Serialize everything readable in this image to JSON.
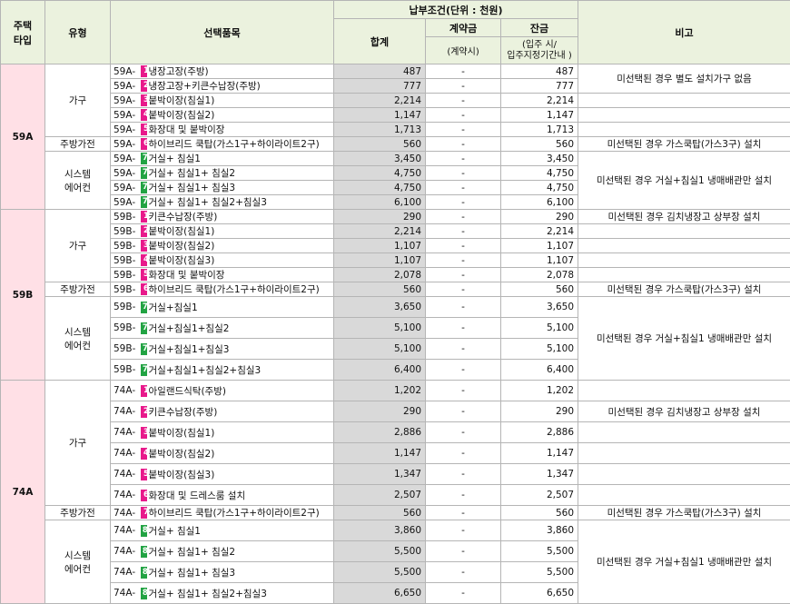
{
  "header": {
    "housing_type": "주택\n타입",
    "category": "유형",
    "item": "선택품목",
    "payment": "납부조건(단위 : 천원)",
    "total": "합계",
    "contract": "계약금",
    "contract_sub": "(계약시)",
    "balance": "잔금",
    "balance_sub": "(입주 시/\n입주지정기간내 )",
    "note": "비고"
  },
  "colors": {
    "header_bg": "#ebf2de",
    "type_bg": "#ffe0e6",
    "total_bg": "#d9d9d9",
    "pink_badge": "#e8198b",
    "green_badge": "#22a343"
  },
  "types": [
    {
      "name": "59A",
      "groups": [
        {
          "category": "가구",
          "rows": [
            {
              "code": "59A-",
              "badge": "1",
              "color": "pink",
              "name": "냉장고장(주방)",
              "total": "487",
              "contract": "-",
              "balance": "487"
            },
            {
              "code": "59A-",
              "badge": "2",
              "color": "pink",
              "name": "냉장고장+키큰수납장(주방)",
              "total": "777",
              "contract": "-",
              "balance": "777"
            },
            {
              "code": "59A-",
              "badge": "3",
              "color": "pink",
              "name": "붙박이장(침실1)",
              "total": "2,214",
              "contract": "-",
              "balance": "2,214"
            },
            {
              "code": "59A-",
              "badge": "4",
              "color": "pink",
              "name": "붙박이장(침실2)",
              "total": "1,147",
              "contract": "-",
              "balance": "1,147"
            },
            {
              "code": "59A-",
              "badge": "5",
              "color": "pink",
              "name": "화장대 및 붙박이장",
              "total": "1,713",
              "contract": "-",
              "balance": "1,713"
            }
          ]
        },
        {
          "category": "주방가전",
          "rows": [
            {
              "code": "59A-",
              "badge": "6",
              "color": "pink",
              "name": "하이브리드 쿡탑(가스1구+하이라이트2구)",
              "total": "560",
              "contract": "-",
              "balance": "560"
            }
          ]
        },
        {
          "category": "시스템\n에어컨",
          "rows": [
            {
              "code": "59A-",
              "badge": "7-1",
              "color": "green",
              "name": "거실+ 침실1",
              "total": "3,450",
              "contract": "-",
              "balance": "3,450"
            },
            {
              "code": "59A-",
              "badge": "7-2",
              "color": "green",
              "name": "거실+ 침실1+ 침실2",
              "total": "4,750",
              "contract": "-",
              "balance": "4,750"
            },
            {
              "code": "59A-",
              "badge": "7-3",
              "color": "green",
              "name": "거실+ 침실1+ 침실3",
              "total": "4,750",
              "contract": "-",
              "balance": "4,750"
            },
            {
              "code": "59A-",
              "badge": "7-4",
              "color": "green",
              "name": "거실+ 침실1+ 침실2+침실3",
              "total": "6,100",
              "contract": "-",
              "balance": "6,100"
            }
          ]
        }
      ],
      "notes": [
        {
          "row": 0,
          "span": 2,
          "text": "미선택된 경우 별도 설치가구 없음"
        },
        {
          "row": 2,
          "span": 1,
          "text": ""
        },
        {
          "row": 3,
          "span": 1,
          "text": ""
        },
        {
          "row": 4,
          "span": 1,
          "text": ""
        },
        {
          "row": 5,
          "span": 1,
          "text": "미선택된 경우 가스쿡탑(가스3구) 설치"
        },
        {
          "row": 6,
          "span": 4,
          "text": "미선택된 경우 거실+침실1 냉매배관만 설치"
        }
      ]
    },
    {
      "name": "59B",
      "groups": [
        {
          "category": "가구",
          "rows": [
            {
              "code": "59B-",
              "badge": "1",
              "color": "pink",
              "name": "키큰수납장(주방)",
              "total": "290",
              "contract": "-",
              "balance": "290"
            },
            {
              "code": "59B-",
              "badge": "2",
              "color": "pink",
              "name": "붙박이장(침실1)",
              "total": "2,214",
              "contract": "-",
              "balance": "2,214"
            },
            {
              "code": "59B-",
              "badge": "3",
              "color": "pink",
              "name": "붙박이장(침실2)",
              "total": "1,107",
              "contract": "-",
              "balance": "1,107"
            },
            {
              "code": "59B-",
              "badge": "4",
              "color": "pink",
              "name": "붙박이장(침실3)",
              "total": "1,107",
              "contract": "-",
              "balance": "1,107"
            },
            {
              "code": "59B-",
              "badge": "5",
              "color": "pink",
              "name": "화장대 및 붙박이장",
              "total": "2,078",
              "contract": "-",
              "balance": "2,078"
            }
          ]
        },
        {
          "category": "주방가전",
          "rows": [
            {
              "code": "59B-",
              "badge": "6",
              "color": "pink",
              "name": "하이브리드 쿡탑(가스1구+하이라이트2구)",
              "total": "560",
              "contract": "-",
              "balance": "560"
            }
          ]
        },
        {
          "category": "시스템\n에어컨",
          "tall": true,
          "rows": [
            {
              "code": "59B-",
              "badge": "7-1",
              "color": "green",
              "name": "거실+침실1",
              "total": "3,650",
              "contract": "-",
              "balance": "3,650"
            },
            {
              "code": "59B-",
              "badge": "7-2",
              "color": "green",
              "name": "거실+침실1+침실2",
              "total": "5,100",
              "contract": "-",
              "balance": "5,100"
            },
            {
              "code": "59B-",
              "badge": "7-3",
              "color": "green",
              "name": "거실+침실1+침실3",
              "total": "5,100",
              "contract": "-",
              "balance": "5,100"
            },
            {
              "code": "59B-",
              "badge": "7-4",
              "color": "green",
              "name": "거실+침실1+침실2+침실3",
              "total": "6,400",
              "contract": "-",
              "balance": "6,400"
            }
          ]
        }
      ],
      "notes": [
        {
          "row": 0,
          "span": 1,
          "text": "미선택된 경우 김치냉장고 상부장 설치"
        },
        {
          "row": 1,
          "span": 1,
          "text": ""
        },
        {
          "row": 2,
          "span": 1,
          "text": ""
        },
        {
          "row": 3,
          "span": 1,
          "text": ""
        },
        {
          "row": 4,
          "span": 1,
          "text": ""
        },
        {
          "row": 5,
          "span": 1,
          "text": "미선택된 경우 가스쿡탑(가스3구) 설치"
        },
        {
          "row": 6,
          "span": 4,
          "text": "미선택된 경우 거실+침실1 냉매배관만 설치"
        }
      ]
    },
    {
      "name": "74A",
      "groups": [
        {
          "category": "가구",
          "tall": true,
          "rows": [
            {
              "code": "74A-",
              "badge": "1",
              "color": "pink",
              "name": "아일랜드식탁(주방)",
              "total": "1,202",
              "contract": "-",
              "balance": "1,202"
            },
            {
              "code": "74A-",
              "badge": "2",
              "color": "pink",
              "name": "키큰수납장(주방)",
              "total": "290",
              "contract": "-",
              "balance": "290"
            },
            {
              "code": "74A-",
              "badge": "3",
              "color": "pink",
              "name": "붙박이장(침실1)",
              "total": "2,886",
              "contract": "-",
              "balance": "2,886"
            },
            {
              "code": "74A-",
              "badge": "4",
              "color": "pink",
              "name": "붙박이장(침실2)",
              "total": "1,147",
              "contract": "-",
              "balance": "1,147"
            },
            {
              "code": "74A-",
              "badge": "5",
              "color": "pink",
              "name": "붙박이장(침실3)",
              "total": "1,347",
              "contract": "-",
              "balance": "1,347"
            },
            {
              "code": "74A-",
              "badge": "6",
              "color": "pink",
              "name": "화장대 및 드레스룸 설치",
              "total": "2,507",
              "contract": "-",
              "balance": "2,507"
            }
          ]
        },
        {
          "category": "주방가전",
          "rows": [
            {
              "code": "74A-",
              "badge": "7",
              "color": "pink",
              "name": "하이브리드 쿡탑(가스1구+하이라이트2구)",
              "total": "560",
              "contract": "-",
              "balance": "560"
            }
          ]
        },
        {
          "category": "시스템\n에어컨",
          "tall": true,
          "rows": [
            {
              "code": "74A-",
              "badge": "8-1",
              "color": "green",
              "name": "거실+ 침실1",
              "total": "3,860",
              "contract": "-",
              "balance": "3,860"
            },
            {
              "code": "74A-",
              "badge": "8-2",
              "color": "green",
              "name": "거실+ 침실1+ 침실2",
              "total": "5,500",
              "contract": "-",
              "balance": "5,500"
            },
            {
              "code": "74A-",
              "badge": "8-3",
              "color": "green",
              "name": "거실+ 침실1+ 침실3",
              "total": "5,500",
              "contract": "-",
              "balance": "5,500"
            },
            {
              "code": "74A-",
              "badge": "8-4",
              "color": "green",
              "name": "거실+ 침실1+ 침실2+침실3",
              "total": "6,650",
              "contract": "-",
              "balance": "6,650"
            }
          ]
        }
      ],
      "notes": [
        {
          "row": 0,
          "span": 1,
          "text": ""
        },
        {
          "row": 1,
          "span": 1,
          "text": "미선택된 경우 김치냉장고 상부장 설치"
        },
        {
          "row": 2,
          "span": 1,
          "text": ""
        },
        {
          "row": 3,
          "span": 1,
          "text": ""
        },
        {
          "row": 4,
          "span": 1,
          "text": ""
        },
        {
          "row": 5,
          "span": 1,
          "text": ""
        },
        {
          "row": 6,
          "span": 1,
          "text": "미선택된 경우 가스쿡탑(가스3구) 설치"
        },
        {
          "row": 7,
          "span": 4,
          "text": "미선택된 경우 거실+침실1 냉매배관만 설치"
        }
      ]
    }
  ]
}
